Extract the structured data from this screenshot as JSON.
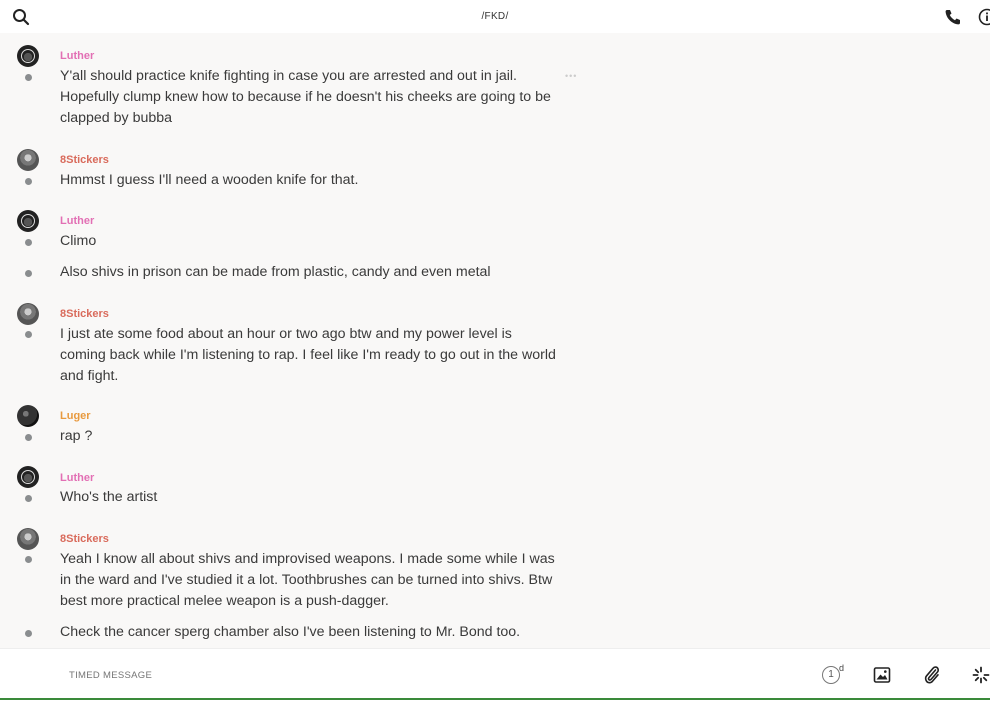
{
  "header": {
    "title": "/FKD/",
    "icons": [
      "search-icon",
      "phone-icon",
      "info-icon"
    ]
  },
  "messages": [
    {
      "sender": "Luther",
      "text": "Y'all should practice knife fighting in case you are arrested and out in jail. Hopefully clump knew how to because if he doesn't his cheeks are going to be clapped by bubba"
    },
    {
      "sender": "8Stickers",
      "text": "Hmmst I guess I'll need a wooden knife for that."
    },
    {
      "sender": "Luther",
      "text": "Climo"
    },
    {
      "sender": "",
      "text": "Also shivs in prison can be made from plastic, candy and even metal"
    },
    {
      "sender": "8Stickers",
      "text": "I just ate some food about an hour or two ago btw and my power level is coming back while I'm listening to rap. I feel like I'm ready to go out in the world and fight."
    },
    {
      "sender": "Luger",
      "text": "rap ?"
    },
    {
      "sender": "Luther",
      "text": "Who's the artist"
    },
    {
      "sender": "8Stickers",
      "text": "Yeah I know all about shivs and improvised weapons. I made some while I was in the ward and I've studied it a lot. Toothbrushes can be turned into shivs. Btw best more practical melee weapon is a push-dagger."
    },
    {
      "sender": "",
      "text": "Check the cancer sperg chamber also I've been listening to Mr. Bond too."
    }
  ],
  "composer": {
    "placeholder": "TIMED MESSAGE",
    "timer_value": "1",
    "timer_unit": "d",
    "icons": [
      "image-icon",
      "paperclip-icon",
      "sparkle-icon"
    ]
  },
  "colors": {
    "luther": "#e26fb4",
    "stickers": "#d96b5c",
    "luger": "#e89a3f",
    "background": "#f9f8f7"
  }
}
